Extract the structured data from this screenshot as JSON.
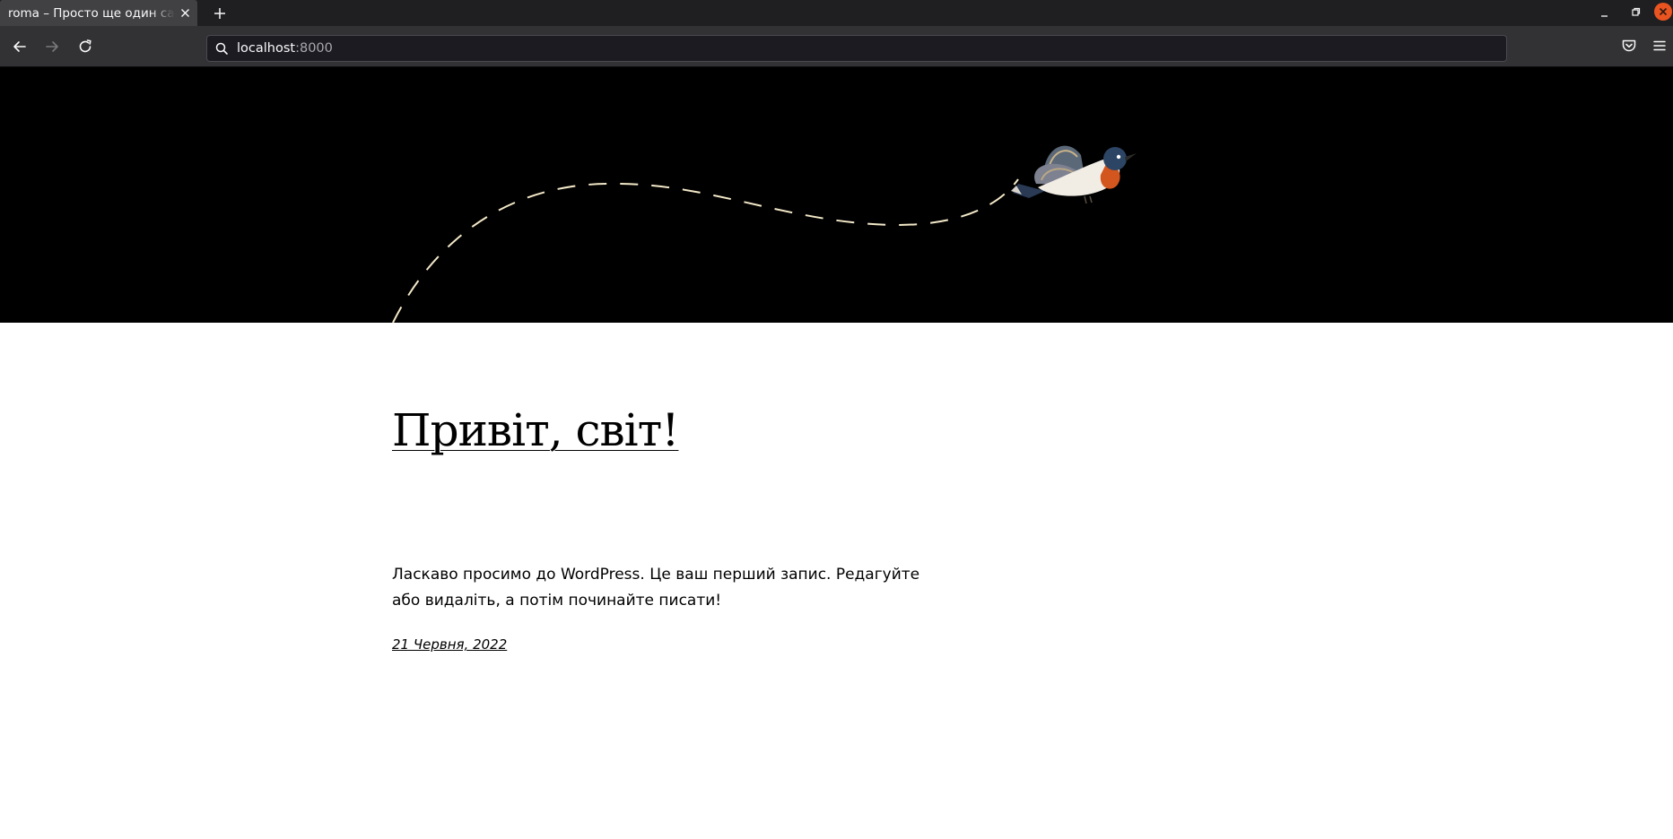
{
  "browser": {
    "tab": {
      "title": "roma – Просто ще один сайт"
    },
    "url": {
      "host": "localhost",
      "port": ":8000"
    },
    "icons": {
      "tab_close": "close-icon",
      "new_tab": "plus-icon",
      "back": "arrow-left-icon",
      "forward": "arrow-right-icon",
      "reload": "reload-icon",
      "search": "search-icon",
      "pocket": "pocket-icon",
      "menu": "hamburger-menu-icon",
      "minimize": "minimize-icon",
      "restore": "restore-icon",
      "close_window": "close-window-icon"
    },
    "colors": {
      "tabstrip": "#1f1f21",
      "tab_active": "#414144",
      "toolbar": "#323234",
      "urlbar": "#1c1b22",
      "window_close": "#e95420"
    }
  },
  "page": {
    "header": {
      "image": "bird-flying-dashed-path",
      "background": "#000000",
      "path_color": "#f3e8c8"
    },
    "post": {
      "title": "Привіт, світ!",
      "excerpt": "Ласкаво просимо до WordPress. Це ваш перший запис. Редагуйте або видаліть, а потім починайте писати!",
      "date": "21 Червня, 2022"
    }
  }
}
